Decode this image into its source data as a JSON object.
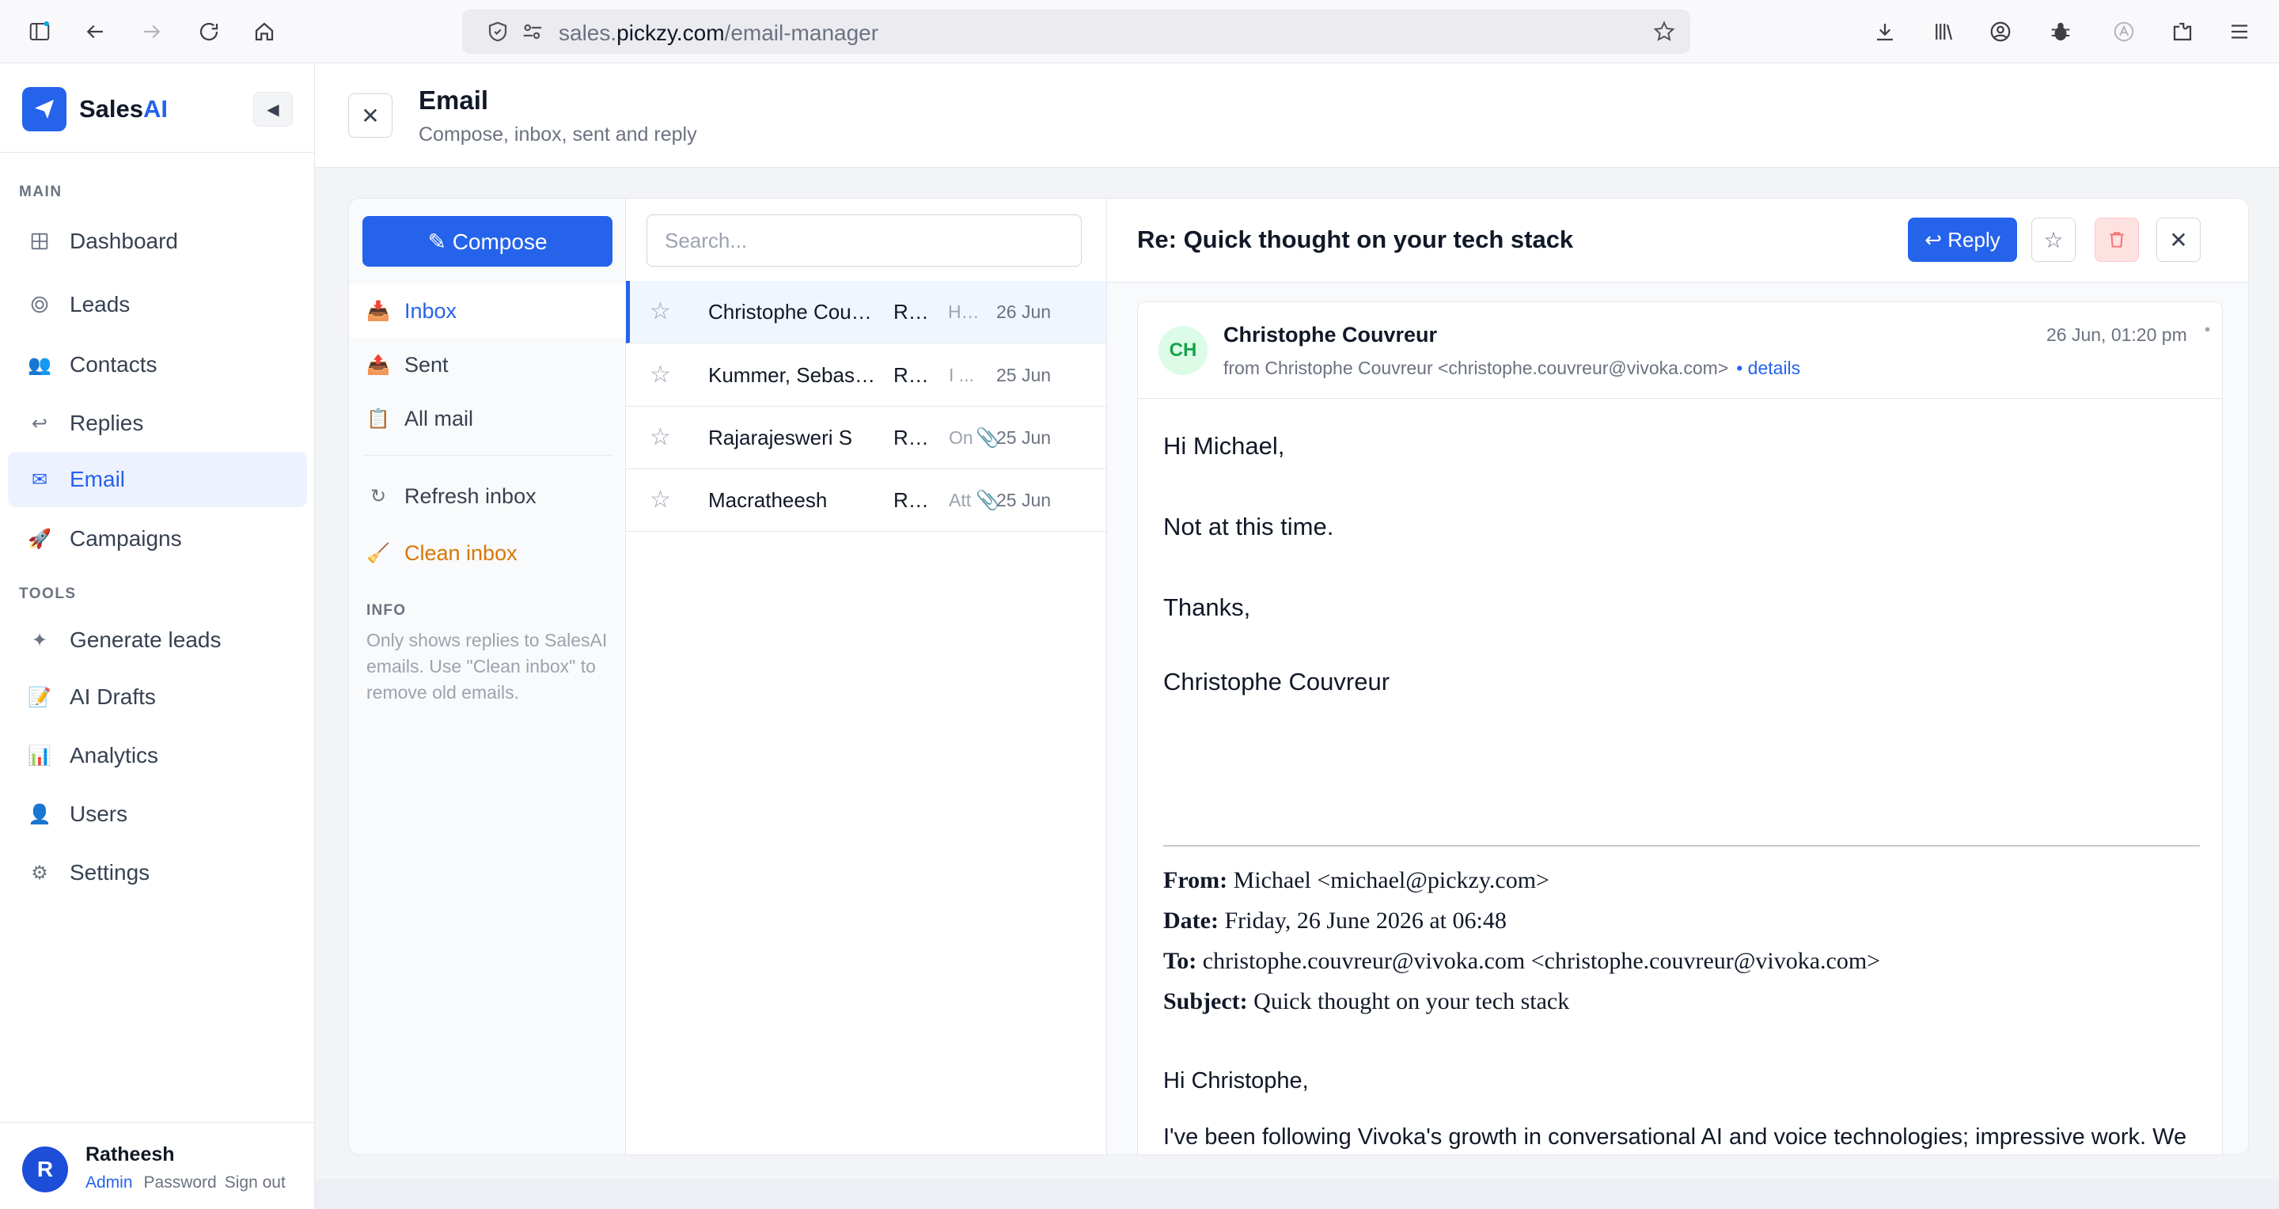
{
  "browser": {
    "url_host_pre": "sales.",
    "url_host_main": "pickzy.com",
    "url_path": "/email-manager"
  },
  "sidebar": {
    "brand_primary": "Sales",
    "brand_accent": "AI",
    "sections": {
      "main": "MAIN",
      "tools": "TOOLS"
    },
    "main_items": [
      {
        "label": "Dashboard",
        "icon": "grid-icon"
      },
      {
        "label": "Leads",
        "icon": "target-icon"
      },
      {
        "label": "Contacts",
        "icon": "people-icon"
      },
      {
        "label": "Replies",
        "icon": "reply-icon"
      },
      {
        "label": "Email",
        "icon": "mail-icon",
        "active": true
      },
      {
        "label": "Campaigns",
        "icon": "rocket-icon"
      }
    ],
    "tool_items": [
      {
        "label": "Generate leads",
        "icon": "sparkle-icon"
      },
      {
        "label": "AI Drafts",
        "icon": "memo-icon"
      },
      {
        "label": "Analytics",
        "icon": "bar-chart-icon"
      },
      {
        "label": "Users",
        "icon": "user-icon"
      },
      {
        "label": "Settings",
        "icon": "gear-icon"
      }
    ],
    "user": {
      "initial": "R",
      "name": "Ratheesh",
      "role": "Admin",
      "password_link": "Password",
      "signout_link": "Sign out"
    }
  },
  "header": {
    "title": "Email",
    "subtitle": "Compose, inbox, sent and reply"
  },
  "folders": {
    "compose_label": "✎ Compose",
    "items": [
      {
        "label": "Inbox",
        "active": true
      },
      {
        "label": "Sent"
      },
      {
        "label": "All mail"
      }
    ],
    "refresh_label": "Refresh inbox",
    "clean_label": "Clean inbox",
    "info_title": "INFO",
    "info_text": "Only shows replies to SalesAI emails. Use \"Clean inbox\" to remove old emails."
  },
  "list": {
    "search_placeholder": "Search...",
    "messages": [
      {
        "from": "Christophe Couvreur",
        "subject": "Re: Quick thought on your tech stack",
        "snippet": "Hi Michael,",
        "attachment": false,
        "date": "26 Jun"
      },
      {
        "from": "Kummer, Sebastian",
        "subject": "Re: Quick thought",
        "snippet": "I ...",
        "attachment": false,
        "date": "25 Jun"
      },
      {
        "from": "Rajarajesweri S",
        "subject": "Re: Quick thought",
        "snippet": "On",
        "attachment": true,
        "date": "25 Jun"
      },
      {
        "from": "Macratheesh",
        "subject": "Re: Quick thought",
        "snippet": "Att",
        "attachment": true,
        "date": "25 Jun"
      }
    ]
  },
  "reader": {
    "subject": "Re: Quick thought on your tech stack",
    "reply_label": "↩ Reply",
    "sender_initials": "CH",
    "sender_name": "Christophe Couvreur",
    "sender_line": "from Christophe Couvreur <christophe.couvreur@vivoka.com>",
    "details_link": "• details",
    "date": "26 Jun, 01:20 pm",
    "dot": "•",
    "body": {
      "greeting": "Hi Michael,",
      "line1": "Not at this time.",
      "thanks": "Thanks,",
      "signature": "Christophe Couvreur"
    },
    "quote": {
      "from_label": "From:",
      "from_value": "Michael <michael@pickzy.com>",
      "date_label": "Date:",
      "date_value": "Friday, 26 June 2026 at 06:48",
      "to_label": "To:",
      "to_value": "christophe.couvreur@vivoka.com <christophe.couvreur@vivoka.com>",
      "subject_label": "Subject:",
      "subject_value": "Quick thought on your tech stack",
      "greeting": "Hi Christophe,",
      "paragraph": "I've been following Vivoka's growth in conversational AI and voice technologies; impressive work. We work with companies like yours on custom software, whether that's web applications, backend"
    }
  }
}
